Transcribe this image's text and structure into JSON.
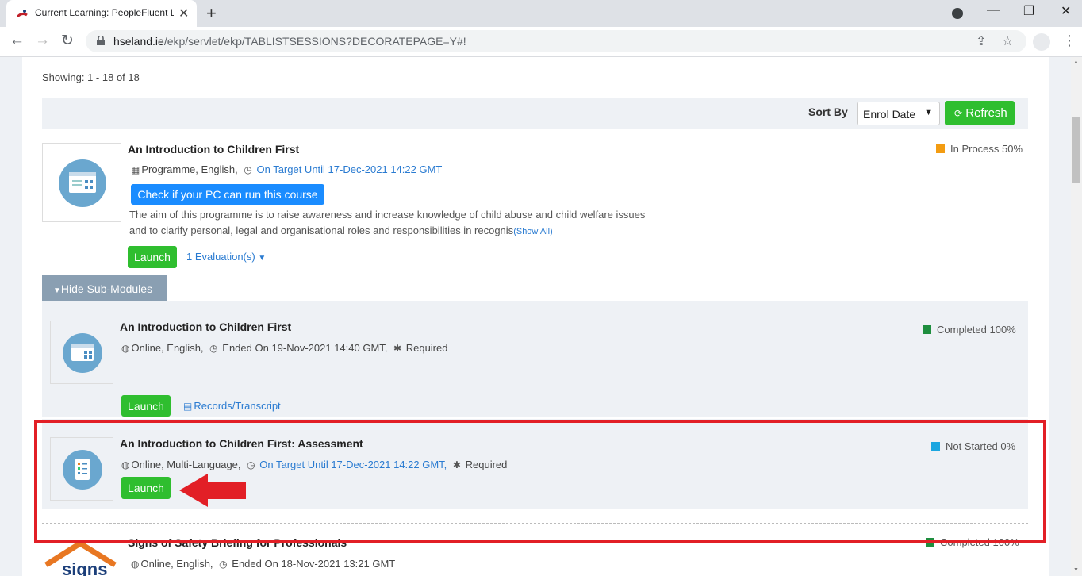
{
  "browser": {
    "tab_title": "Current Learning: PeopleFluent LMS",
    "url_host": "hseland.ie",
    "url_path": "/ekp/servlet/ekp/TABLISTSESSIONS?DECORATEPAGE=Y#!"
  },
  "list": {
    "showing": "Showing: 1 - 18 of 18",
    "sort_label": "Sort By",
    "sort_value": "Enrol Date",
    "refresh_label": "Refresh"
  },
  "course": {
    "title": "An Introduction to Children First",
    "meta_type": "Programme, English,",
    "meta_target": "On Target Until 17-Dec-2021 14:22 GMT",
    "check_button": "Check if your PC can run this course",
    "description": "The aim of this programme is to raise awareness and increase knowledge of child abuse and child welfare issues and to clarify personal, legal and organisational roles and responsibilities in recognis",
    "show_all": "(Show All)",
    "launch_label": "Launch",
    "evaluations": "1 Evaluation(s)",
    "status": "In Process 50%",
    "status_color": "#f39c12"
  },
  "hide_sub_label": "Hide Sub-Modules",
  "sub1": {
    "title": "An Introduction to Children First",
    "meta_type": "Online, English,",
    "meta_date": "Ended On 19-Nov-2021 14:40 GMT,",
    "required": "Required",
    "launch_label": "Launch",
    "records": "Records/Transcript",
    "status": "Completed 100%",
    "status_color": "#1e8e3e"
  },
  "sub2": {
    "title": "An Introduction to Children First: Assessment",
    "meta_type": "Online, Multi-Language,",
    "meta_target": "On Target Until 17-Dec-2021 14:22 GMT,",
    "required": "Required",
    "launch_label": "Launch",
    "status": "Not Started 0%",
    "status_color": "#1aa6e0"
  },
  "next_course": {
    "title": "Signs of Safety Briefing for Professionals",
    "meta_type": "Online, English,",
    "meta_date": "Ended On 18-Nov-2021 13:21 GMT",
    "status": "Completed 100%",
    "status_color": "#1e8e3e",
    "logo_text": "signs"
  }
}
